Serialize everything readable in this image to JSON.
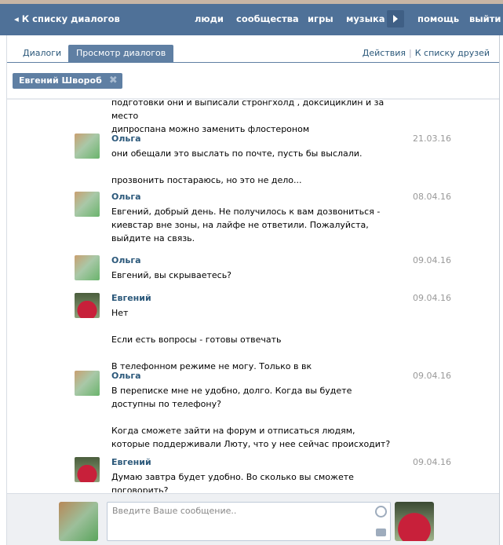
{
  "header": {
    "back": "К списку диалогов",
    "nav": [
      "люди",
      "сообщества",
      "игры",
      "музыка",
      "помощь",
      "выйти"
    ]
  },
  "tabs": {
    "dialogs": "Диалоги",
    "view": "Просмотр диалогов",
    "actions": "Действия",
    "sep": "|",
    "friends": "К списку друзей"
  },
  "chip": {
    "name": "Евгений Швороб",
    "close": "✖"
  },
  "continuation": [
    "подготовки они и выписали стронгхолд , доксициклин и за место",
    "дипроспана можно заменить флостероном"
  ],
  "messages": [
    {
      "author": "Ольга",
      "date": "21.03.16",
      "lines": [
        "они обещали это выслать по почте, пусть бы выслали.",
        "прозвонить постараюсь, но это не дело..."
      ]
    },
    {
      "author": "Ольга",
      "date": "08.04.16",
      "lines": [
        "Евгений, добрый день. Не получилось к вам дозвониться - киевстар вне зоны, на лайфе не ответили. Пожалуйста, выйдите на связь."
      ]
    },
    {
      "author": "Ольга",
      "date": "09.04.16",
      "lines": [
        "Евгений, вы скрываетесь?"
      ]
    },
    {
      "author": "Евгений",
      "date": "09.04.16",
      "lines": [
        "Нет",
        "Если есть вопросы - готовы отвечать",
        "В телефонном режиме не могу. Только в вк"
      ]
    },
    {
      "author": "Ольга",
      "date": "09.04.16",
      "lines": [
        "В переписке мне не удобно, долго. Когда вы будете доступны по телефону?",
        "Когда сможете зайти на форум и отписаться людям, которые поддерживали Люту, что у нее сейчас происходит?"
      ]
    },
    {
      "author": "Евгений",
      "date": "09.04.16",
      "lines": [
        "Думаю завтра будет удобно. Во сколько вы сможете поговорить?"
      ]
    }
  ],
  "composer": {
    "placeholder": "Введите Ваше сообщение.."
  }
}
